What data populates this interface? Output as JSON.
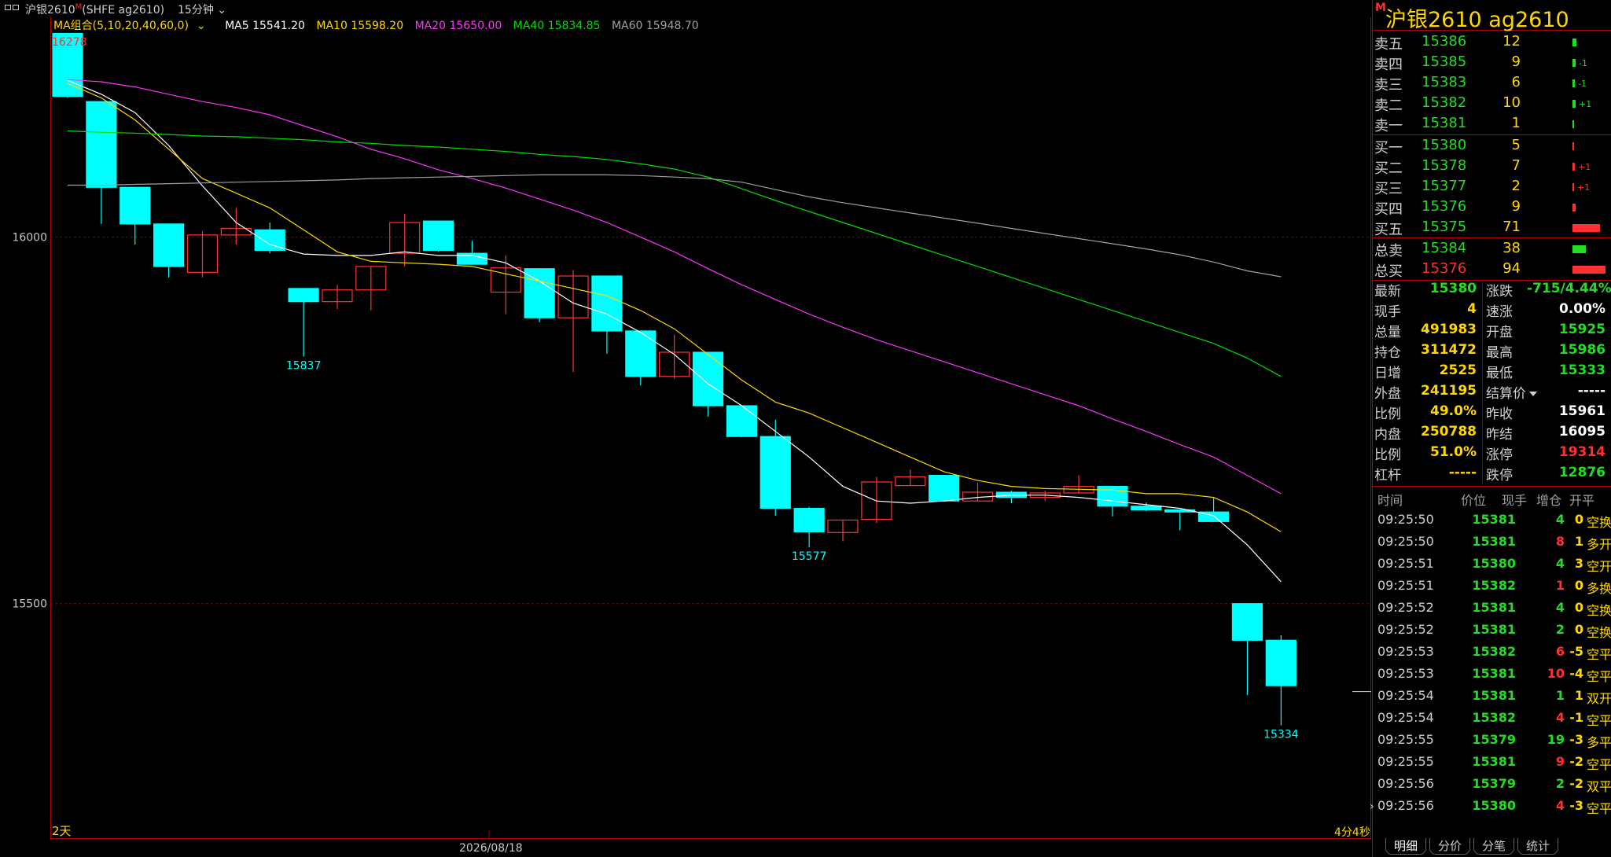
{
  "window": {
    "symbol_title": "沪银2610",
    "title_badge": "M",
    "exchange": "(SHFE ag2610)",
    "period": "15分钟"
  },
  "ma_legend": {
    "combo": "MA组合(5,10,20,40,60,0)",
    "items": [
      {
        "label": "MA5 15541.20",
        "color": "#ffffff"
      },
      {
        "label": "MA10 15598.20",
        "color": "#ffd700"
      },
      {
        "label": "MA20 15650.00",
        "color": "#ff33ff"
      },
      {
        "label": "MA40 15834.85",
        "color": "#00dd00"
      },
      {
        "label": "MA60 15948.70",
        "color": "#a0a0a0"
      }
    ]
  },
  "chart_data": {
    "type": "candlestick",
    "y_range": [
      15180,
      16300
    ],
    "y_ticks": [
      16000,
      15500
    ],
    "x_label_date": "2026/08/18",
    "bottom_left_label": "2天",
    "bottom_right_label": "4分4秒",
    "up_color": "#ff3333",
    "down_color": "#00ffff",
    "annotations": [
      {
        "candle": 0,
        "value": 16278,
        "position": "above",
        "color": "#ff3333"
      },
      {
        "candle": 7,
        "value": 15837,
        "position": "below",
        "color": "#00ffff"
      },
      {
        "candle": 22,
        "value": 15577,
        "position": "below",
        "color": "#00ffff"
      },
      {
        "candle": 36,
        "value": 15334,
        "position": "below",
        "color": "#00ffff"
      }
    ],
    "candles": [
      {
        "o": 16278,
        "h": 16278,
        "l": 16190,
        "c": 16192
      },
      {
        "o": 16185,
        "h": 16185,
        "l": 16018,
        "c": 16068
      },
      {
        "o": 16068,
        "h": 16068,
        "l": 15990,
        "c": 16018
      },
      {
        "o": 16018,
        "h": 16018,
        "l": 15945,
        "c": 15960
      },
      {
        "o": 15952,
        "h": 16008,
        "l": 15945,
        "c": 16003
      },
      {
        "o": 16003,
        "h": 16040,
        "l": 15990,
        "c": 16012
      },
      {
        "o": 16010,
        "h": 16020,
        "l": 15978,
        "c": 15982
      },
      {
        "o": 15930,
        "h": 15930,
        "l": 15837,
        "c": 15912
      },
      {
        "o": 15912,
        "h": 15935,
        "l": 15902,
        "c": 15928
      },
      {
        "o": 15928,
        "h": 15960,
        "l": 15900,
        "c": 15960
      },
      {
        "o": 15978,
        "h": 16032,
        "l": 15960,
        "c": 16020
      },
      {
        "o": 16022,
        "h": 16022,
        "l": 15980,
        "c": 15982
      },
      {
        "o": 15978,
        "h": 15995,
        "l": 15963,
        "c": 15963
      },
      {
        "o": 15925,
        "h": 15975,
        "l": 15895,
        "c": 15958
      },
      {
        "o": 15957,
        "h": 15957,
        "l": 15884,
        "c": 15890
      },
      {
        "o": 15890,
        "h": 15955,
        "l": 15816,
        "c": 15947
      },
      {
        "o": 15947,
        "h": 15947,
        "l": 15841,
        "c": 15872
      },
      {
        "o": 15872,
        "h": 15872,
        "l": 15798,
        "c": 15810
      },
      {
        "o": 15810,
        "h": 15867,
        "l": 15807,
        "c": 15843
      },
      {
        "o": 15843,
        "h": 15843,
        "l": 15755,
        "c": 15770
      },
      {
        "o": 15770,
        "h": 15770,
        "l": 15727,
        "c": 15728
      },
      {
        "o": 15728,
        "h": 15751,
        "l": 15620,
        "c": 15630
      },
      {
        "o": 15630,
        "h": 15632,
        "l": 15577,
        "c": 15598
      },
      {
        "o": 15597,
        "h": 15613,
        "l": 15585,
        "c": 15614
      },
      {
        "o": 15615,
        "h": 15673,
        "l": 15610,
        "c": 15666
      },
      {
        "o": 15661,
        "h": 15683,
        "l": 15661,
        "c": 15673
      },
      {
        "o": 15675,
        "h": 15675,
        "l": 15640,
        "c": 15640
      },
      {
        "o": 15640,
        "h": 15665,
        "l": 15640,
        "c": 15652
      },
      {
        "o": 15652,
        "h": 15654,
        "l": 15637,
        "c": 15645
      },
      {
        "o": 15645,
        "h": 15654,
        "l": 15640,
        "c": 15651
      },
      {
        "o": 15651,
        "h": 15675,
        "l": 15650,
        "c": 15660
      },
      {
        "o": 15660,
        "h": 15660,
        "l": 15619,
        "c": 15633
      },
      {
        "o": 15633,
        "h": 15638,
        "l": 15626,
        "c": 15628
      },
      {
        "o": 15628,
        "h": 15628,
        "l": 15600,
        "c": 15625
      },
      {
        "o": 15625,
        "h": 15644,
        "l": 15612,
        "c": 15612
      },
      {
        "o": 15500,
        "h": 15500,
        "l": 15375,
        "c": 15450
      },
      {
        "o": 15450,
        "h": 15457,
        "l": 15334,
        "c": 15388
      }
    ],
    "ma_series": [
      {
        "name": "MA5",
        "color": "#ffffff",
        "values": [
          16214,
          16195,
          16170,
          16125,
          16070,
          16020,
          15990,
          15977,
          15975,
          15975,
          15980,
          15975,
          15975,
          15965,
          15940,
          15910,
          15895,
          15870,
          15840,
          15800,
          15770,
          15735,
          15700,
          15660,
          15640,
          15637,
          15640,
          15645,
          15648,
          15648,
          15645,
          15640,
          15635,
          15630,
          15620,
          15580,
          15530
        ]
      },
      {
        "name": "MA10",
        "color": "#ffd700",
        "values": [
          16210,
          16190,
          16160,
          16120,
          16080,
          16060,
          16040,
          16010,
          15980,
          15967,
          15965,
          15963,
          15960,
          15950,
          15940,
          15930,
          15920,
          15900,
          15875,
          15840,
          15805,
          15775,
          15760,
          15740,
          15720,
          15700,
          15680,
          15668,
          15660,
          15657,
          15656,
          15655,
          15650,
          15650,
          15645,
          15625,
          15598
        ]
      },
      {
        "name": "MA20",
        "color": "#ff33ff",
        "values": [
          16215,
          16212,
          16205,
          16195,
          16185,
          16177,
          16167,
          16152,
          16137,
          16120,
          16107,
          16092,
          16080,
          16067,
          16052,
          16037,
          16020,
          16000,
          15980,
          15957,
          15935,
          15915,
          15895,
          15877,
          15860,
          15845,
          15830,
          15815,
          15800,
          15785,
          15770,
          15752,
          15735,
          15717,
          15700,
          15675,
          15650
        ]
      },
      {
        "name": "MA40",
        "color": "#00dd00",
        "values": [
          16145,
          16143,
          16142,
          16140,
          16138,
          16137,
          16135,
          16133,
          16130,
          16128,
          16125,
          16123,
          16120,
          16117,
          16113,
          16110,
          16106,
          16100,
          16093,
          16082,
          16066,
          16050,
          16035,
          16020,
          16005,
          15990,
          15975,
          15960,
          15945,
          15930,
          15915,
          15900,
          15885,
          15870,
          15855,
          15835,
          15810
        ]
      },
      {
        "name": "MA60",
        "color": "#a0a0a0",
        "values": [
          16071,
          16071,
          16072,
          16073,
          16074,
          16075,
          16076,
          16077,
          16078,
          16080,
          16081,
          16082,
          16083,
          16084,
          16085,
          16085,
          16085,
          16084,
          16082,
          16080,
          16075,
          16065,
          16055,
          16047,
          16040,
          16033,
          16026,
          16019,
          16012,
          16005,
          15998,
          15991,
          15984,
          15976,
          15966,
          15954,
          15946
        ]
      }
    ]
  },
  "right_panel": {
    "badge": "M",
    "title": "沪银2610  ag2610",
    "asks": [
      {
        "label": "卖五",
        "price": "15386",
        "vol": "12",
        "bar": 0.05,
        "chg": ""
      },
      {
        "label": "卖四",
        "price": "15385",
        "vol": "9",
        "bar": 0.04,
        "chg": "-1"
      },
      {
        "label": "卖三",
        "price": "15383",
        "vol": "6",
        "bar": 0.03,
        "chg": "-1"
      },
      {
        "label": "卖二",
        "price": "15382",
        "vol": "10",
        "bar": 0.04,
        "chg": "+1"
      },
      {
        "label": "卖一",
        "price": "15381",
        "vol": "1",
        "bar": 0.0,
        "chg": ""
      }
    ],
    "bids": [
      {
        "label": "买一",
        "price": "15380",
        "vol": "5",
        "bar": 0.02,
        "chg": ""
      },
      {
        "label": "买二",
        "price": "15378",
        "vol": "7",
        "bar": 0.03,
        "chg": "+1"
      },
      {
        "label": "买三",
        "price": "15377",
        "vol": "2",
        "bar": 0.01,
        "chg": "+1"
      },
      {
        "label": "买四",
        "price": "15376",
        "vol": "9",
        "bar": 0.04,
        "chg": ""
      },
      {
        "label": "买五",
        "price": "15375",
        "vol": "71",
        "bar": 0.35,
        "chg": ""
      }
    ],
    "totals": [
      {
        "label": "总卖",
        "price": "15384",
        "vol": "38",
        "bar": 0.17,
        "color": "#22dd22"
      },
      {
        "label": "总买",
        "price": "15376",
        "vol": "94",
        "bar": 0.42,
        "color": "#ff3030"
      }
    ],
    "stats": [
      {
        "l1": "最新",
        "v1": "15380",
        "c1": "#22dd22",
        "l2": "涨跌",
        "v2": "-715/4.44%",
        "c2": "#22dd22"
      },
      {
        "l1": "现手",
        "v1": "4",
        "c1": "#ffd700",
        "l2": "速涨",
        "v2": "0.00%",
        "c2": "#ffffff"
      },
      {
        "l1": "总量",
        "v1": "491983",
        "c1": "#ffd700",
        "l2": "开盘",
        "v2": "15925",
        "c2": "#22dd22"
      },
      {
        "l1": "持仓",
        "v1": "311472",
        "c1": "#ffd700",
        "l2": "最高",
        "v2": "15986",
        "c2": "#22dd22"
      },
      {
        "l1": "日增",
        "v1": "2525",
        "c1": "#ffd700",
        "l2": "最低",
        "v2": "15333",
        "c2": "#22dd22"
      },
      {
        "l1": "外盘",
        "v1": "241195",
        "c1": "#ffd700",
        "l2": "结算价",
        "v2": "-----",
        "c2": "#ffffff"
      },
      {
        "l1": "比例",
        "v1": "49.0%",
        "c1": "#ffd700",
        "l2": "昨收",
        "v2": "15961",
        "c2": "#ffffff"
      },
      {
        "l1": "内盘",
        "v1": "250788",
        "c1": "#ffd700",
        "l2": "昨结",
        "v2": "16095",
        "c2": "#ffffff"
      },
      {
        "l1": "比例",
        "v1": "51.0%",
        "c1": "#ffd700",
        "l2": "涨停",
        "v2": "19314",
        "c2": "#ff3030"
      },
      {
        "l1": "杠杆",
        "v1": "-----",
        "c1": "#ffd700",
        "l2": "跌停",
        "v2": "12876",
        "c2": "#22dd22"
      }
    ],
    "tick_headers": {
      "time": "时间",
      "price": "价位",
      "vol": "现手",
      "oi": "增仓",
      "type": "开平"
    },
    "ticks": [
      {
        "t": "09:25:50",
        "p": "15381",
        "v": "4",
        "vc": "#22dd22",
        "o": "0",
        "k": "空换"
      },
      {
        "t": "09:25:50",
        "p": "15381",
        "v": "8",
        "vc": "#ff3030",
        "o": "1",
        "k": "多开"
      },
      {
        "t": "09:25:51",
        "p": "15380",
        "v": "4",
        "vc": "#22dd22",
        "o": "3",
        "k": "空开"
      },
      {
        "t": "09:25:51",
        "p": "15382",
        "v": "1",
        "vc": "#ff3030",
        "o": "0",
        "k": "多换"
      },
      {
        "t": "09:25:52",
        "p": "15381",
        "v": "4",
        "vc": "#22dd22",
        "o": "0",
        "k": "空换"
      },
      {
        "t": "09:25:52",
        "p": "15381",
        "v": "2",
        "vc": "#22dd22",
        "o": "0",
        "k": "空换"
      },
      {
        "t": "09:25:53",
        "p": "15382",
        "v": "6",
        "vc": "#ff3030",
        "o": "-5",
        "k": "空平"
      },
      {
        "t": "09:25:53",
        "p": "15381",
        "v": "10",
        "vc": "#ff3030",
        "o": "-4",
        "k": "空平"
      },
      {
        "t": "09:25:54",
        "p": "15381",
        "v": "1",
        "vc": "#22dd22",
        "o": "1",
        "k": "双开"
      },
      {
        "t": "09:25:54",
        "p": "15382",
        "v": "4",
        "vc": "#ff3030",
        "o": "-1",
        "k": "空平"
      },
      {
        "t": "09:25:55",
        "p": "15379",
        "v": "19",
        "vc": "#22dd22",
        "o": "-3",
        "k": "多平"
      },
      {
        "t": "09:25:55",
        "p": "15381",
        "v": "9",
        "vc": "#ff3030",
        "o": "-2",
        "k": "空平"
      },
      {
        "t": "09:25:56",
        "p": "15379",
        "v": "2",
        "vc": "#22dd22",
        "o": "-2",
        "k": "双平"
      },
      {
        "t": "09:25:56",
        "p": "15380",
        "v": "4",
        "vc": "#ff3030",
        "o": "-3",
        "k": "空平"
      }
    ],
    "tabs": [
      "明细",
      "分价",
      "分笔",
      "统计"
    ]
  }
}
